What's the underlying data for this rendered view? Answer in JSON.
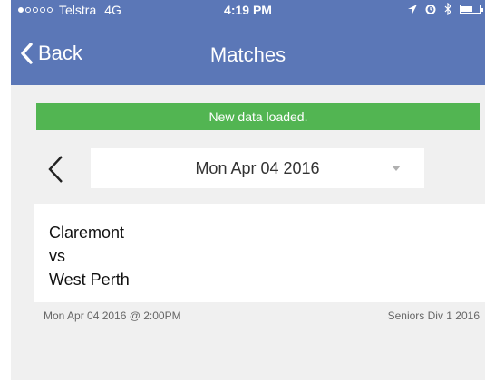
{
  "statusbar": {
    "carrier": "Telstra",
    "network": "4G",
    "time": "4:19 PM",
    "icons": [
      "location-arrow-icon",
      "alarm-icon",
      "bluetooth-icon",
      "battery-icon"
    ]
  },
  "navbar": {
    "back_label": "Back",
    "title": "Matches",
    "color": "#5b77b7"
  },
  "banner": {
    "text": "New data loaded.",
    "color": "#52b552"
  },
  "date_picker": {
    "selected": "Mon Apr 04 2016"
  },
  "matches": [
    {
      "home": "Claremont",
      "vs": "vs",
      "away": "West Perth",
      "datetime": "Mon Apr 04 2016 @ 2:00PM",
      "competition": "Seniors Div 1 2016"
    }
  ]
}
